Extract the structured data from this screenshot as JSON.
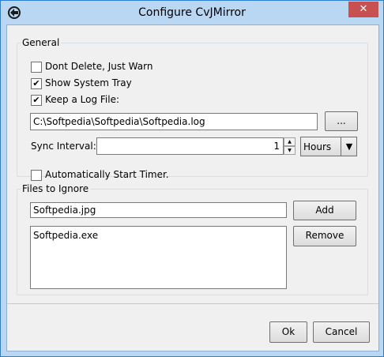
{
  "window": {
    "title": "Configure CvJMirror",
    "close_symbol": "✕"
  },
  "general": {
    "legend": "General",
    "dont_delete": {
      "label": "Dont Delete, Just Warn",
      "checked": false
    },
    "show_tray": {
      "label": "Show System Tray",
      "checked": true
    },
    "keep_log": {
      "label": "Keep a Log File:",
      "checked": true
    },
    "log_path": "C:\\Softpedia\\Softpedia\\Softpedia.log",
    "browse_label": "...",
    "sync_label": "Sync Interval:",
    "sync_value": "1",
    "unit_value": "Hours",
    "auto_start": {
      "label": "Automatically Start Timer.",
      "checked": false
    }
  },
  "ignore": {
    "legend": "Files to Ignore",
    "input_value": "Softpedia.jpg",
    "add_label": "Add",
    "remove_label": "Remove",
    "items": [
      "Softpedia.exe"
    ]
  },
  "footer": {
    "ok_label": "Ok",
    "cancel_label": "Cancel"
  },
  "icons": {
    "check": "✔",
    "spin_up": "▲",
    "spin_down": "▼",
    "dropdown": "▼"
  }
}
